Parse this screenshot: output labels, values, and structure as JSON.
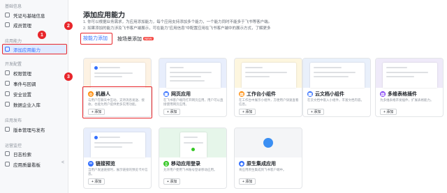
{
  "sidebar": {
    "groups": [
      {
        "title": "基础信息",
        "items": [
          "凭证与基础信息",
          "成员管理"
        ]
      },
      {
        "title": "应用能力",
        "items": [
          "添加应用能力"
        ]
      },
      {
        "title": "开发配置",
        "items": [
          "权限管理",
          "事件与回调",
          "安全设置",
          "数据企业入库"
        ]
      },
      {
        "title": "应用发布",
        "items": [
          "版本管理与发布"
        ]
      },
      {
        "title": "运营监控",
        "items": [
          "日志检索",
          "应用质量看板"
        ]
      }
    ],
    "collapse_icon": "<"
  },
  "main": {
    "title": "添加应用能力",
    "desc1": "1. 你可以根据业务需求，为应用添加能力，每个应用支持添加多个能力，一个能力同时不能多于飞书等客户端。",
    "desc2": "2. 如果添加的能力涉及飞书客户端展示，可在能力\"应用信息\"中配置应用在飞书客户端中的展示方式，了解更多",
    "tabs": [
      {
        "label": "按能力添加",
        "active": true
      },
      {
        "label": "按场景添加",
        "badge": "NEW"
      }
    ],
    "add_label": "+ 添加",
    "cards": [
      {
        "title": "机器人",
        "desc": "与用户在聊天中互动，支持消息发送、接收，也能为用户提供更多实用功能。",
        "icon_color": "#ff8800"
      },
      {
        "title": "网页应用",
        "desc": "在飞书客户端内打开网页应用，用户可以直接使用网页应用。",
        "icon_color": "#3370ff"
      },
      {
        "title": "工作台小组件",
        "desc": "在工作台中展示小组件，方便用户快速查看信息。",
        "icon_color": "#ff8800"
      },
      {
        "title": "云文档小组件",
        "desc": "在云文档中嵌入小组件，丰富文档内容。",
        "icon_color": "#3370ff"
      },
      {
        "title": "多维表格插件",
        "desc": "为多维表格开发插件，扩展表格能力。",
        "icon_color": "#7f3bf5"
      },
      {
        "title": "链接预览",
        "desc": "当用户发送链接时，展示链接的预览卡片信息。",
        "icon_color": "#3370ff"
      },
      {
        "title": "移动应用登录",
        "desc": "允许用户使用飞书账号登录移动应用。",
        "icon_color": "#34c724"
      },
      {
        "title": "原生集成应用",
        "desc": "将应用原生集成到飞书客户端中。",
        "icon_color": "#3370ff"
      }
    ]
  },
  "annotations": [
    "1",
    "2",
    "3"
  ]
}
